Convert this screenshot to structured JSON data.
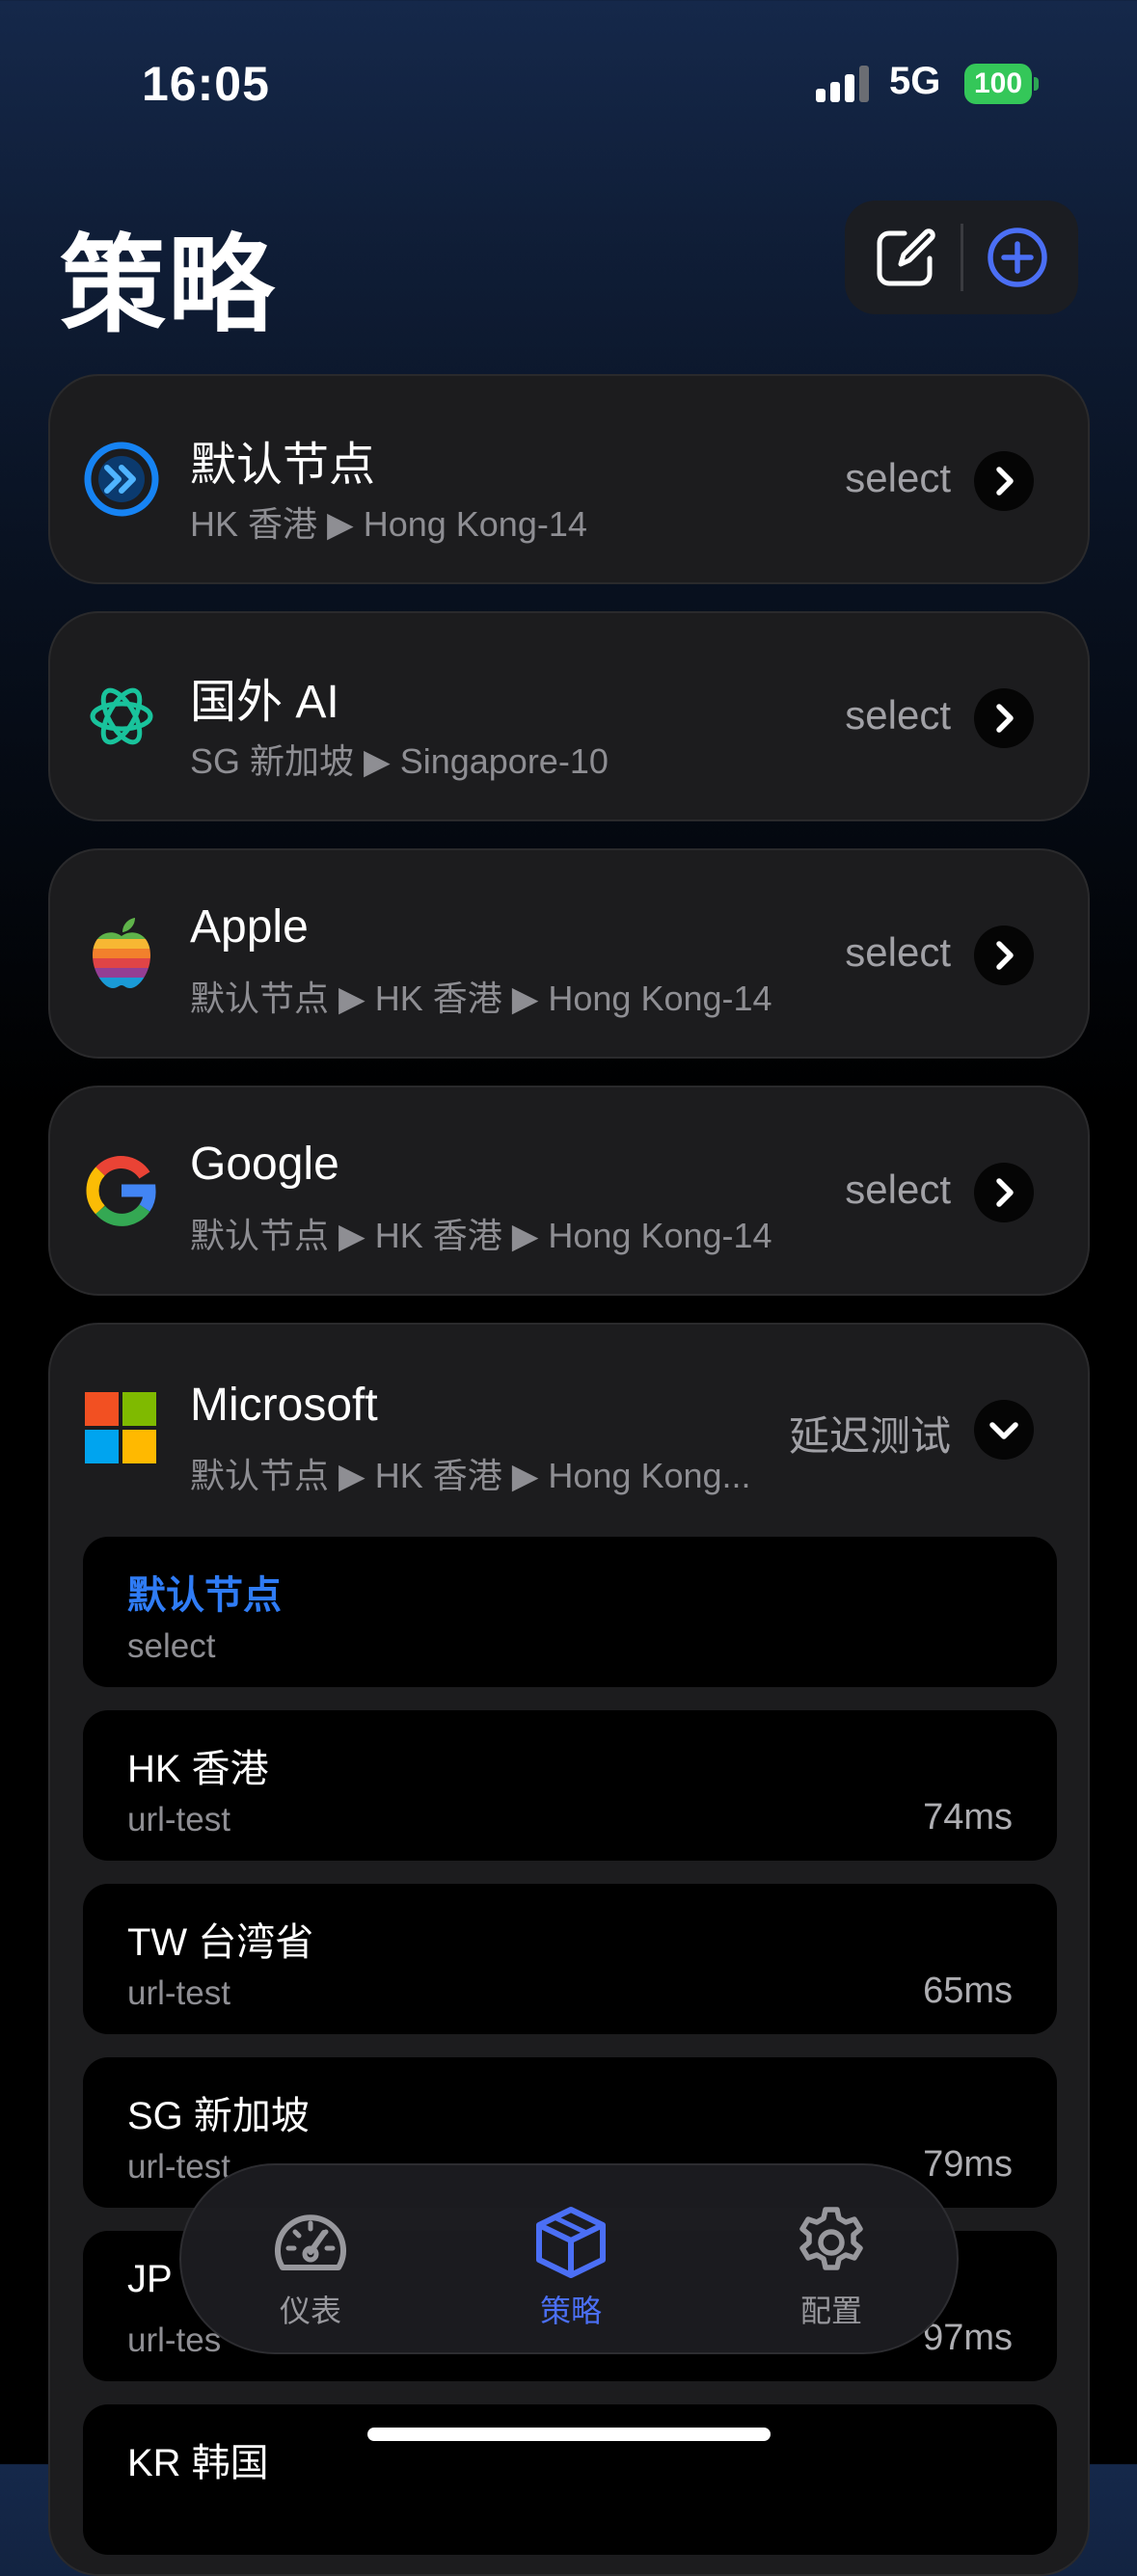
{
  "status": {
    "time": "16:05",
    "network": "5G",
    "battery": "100"
  },
  "header": {
    "title": "策略"
  },
  "policies": [
    {
      "name": "默认节点",
      "path": "HK 香港 ▶ Hong Kong-14",
      "type": "select",
      "icon": "forward-circle-icon"
    },
    {
      "name": "国外 AI",
      "path": "SG 新加坡 ▶ Singapore-10",
      "type": "select",
      "icon": "openai-icon"
    },
    {
      "name": "Apple",
      "path": "默认节点 ▶ HK 香港 ▶ Hong Kong-14",
      "type": "select",
      "icon": "apple-icon"
    },
    {
      "name": "Google",
      "path": "默认节点 ▶ HK 香港 ▶ Hong Kong-14",
      "type": "select",
      "icon": "google-icon"
    }
  ],
  "expanded": {
    "name": "Microsoft",
    "path": "默认节点 ▶ HK 香港 ▶ Hong Kong...",
    "action": "延迟测试",
    "icon": "microsoft-icon",
    "items": [
      {
        "name": "默认节点",
        "type": "select",
        "delay": ""
      },
      {
        "name": "HK 香港",
        "type": "url-test",
        "delay": "74ms"
      },
      {
        "name": "TW 台湾省",
        "type": "url-test",
        "delay": "65ms"
      },
      {
        "name": "SG 新加坡",
        "type": "url-test",
        "delay": "79ms"
      },
      {
        "name": "JP",
        "type": "url-tes",
        "delay": "97ms"
      },
      {
        "name": "KR 韩国",
        "type": "",
        "delay": ""
      }
    ]
  },
  "tabs": [
    {
      "label": "仪表",
      "icon": "gauge-icon"
    },
    {
      "label": "策略",
      "icon": "cube-icon"
    },
    {
      "label": "配置",
      "icon": "gear-icon"
    }
  ],
  "colors": {
    "accent": "#4b6ff5",
    "active_item": "#2f7cf6",
    "battery": "#34c759"
  }
}
